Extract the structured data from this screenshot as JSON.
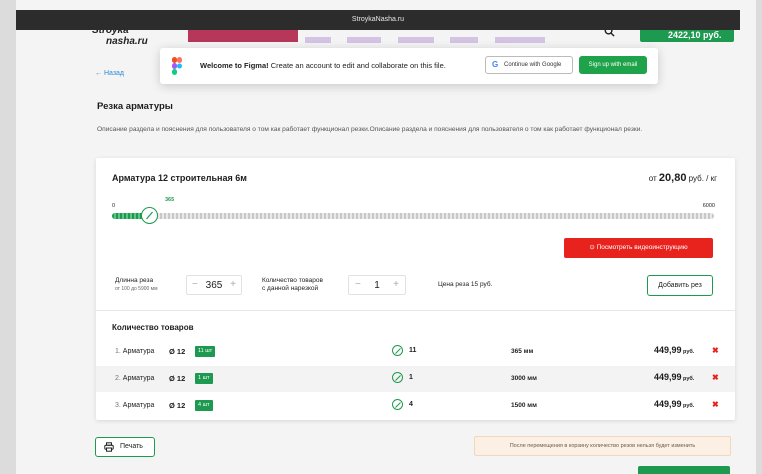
{
  "window": {
    "title": "StroykaNasha.ru"
  },
  "header": {
    "logo_line1": "Stroyka",
    "logo_line2": "nasha.ru",
    "cart_total": "2422,10 руб."
  },
  "figma_banner": {
    "title": "Welcome to Figma!",
    "message": " Create an account to edit and collaborate on this file.",
    "google_btn": "Continue with Google",
    "email_btn": "Sign up with email"
  },
  "nav": {
    "back": "← Назад"
  },
  "page": {
    "title": "Резка арматуры",
    "description": "Описание раздела и пояснения для пользователя о том как работает функционал резки.Описание раздела и пояснения для пользователя о том как работает функционал резки."
  },
  "product": {
    "name": "Арматура 12 строительная 6м",
    "price_prefix": "от ",
    "price_value": "20,80",
    "price_unit": " руб. / кг"
  },
  "slider": {
    "min": "0",
    "max": "6000",
    "value": "365",
    "fraction": 0.061
  },
  "video_button": "⊙  Посмотреть видеоинструкцию",
  "controls": {
    "length_label": "Длинна реза",
    "length_hint": "от 100 до 5900 мм",
    "length_value": "365",
    "qty_label_1": "Количество товаров",
    "qty_label_2": "с данной нарезкой",
    "qty_value": "1",
    "cut_price": "Цена реза 15 руб.",
    "add_button": "Добавить рез",
    "minus": "−",
    "plus": "+"
  },
  "list": {
    "title": "Количество товаров",
    "rows": [
      {
        "idx": "1.",
        "name": "Арматура",
        "dia": "Ø 12",
        "badge": "11 шт",
        "count": "11",
        "length": "365 мм",
        "sum": "449,99",
        "cur": " руб.",
        "del": "✖"
      },
      {
        "idx": "2.",
        "name": "Арматура",
        "dia": "Ø 12",
        "badge": "1 шт",
        "count": "1",
        "length": "3000 мм",
        "sum": "449,99",
        "cur": " руб.",
        "del": "✖"
      },
      {
        "idx": "3.",
        "name": "Арматура",
        "dia": "Ø 12",
        "badge": "4 шт",
        "count": "4",
        "length": "1500 мм",
        "sum": "449,99",
        "cur": " руб.",
        "del": "✖"
      }
    ]
  },
  "footer": {
    "print": "Печать",
    "warning": "После перемещения в корзину количество резов нельзя будет изменить"
  },
  "colors": {
    "accent": "#1d9a4f",
    "danger": "#e8231d"
  }
}
